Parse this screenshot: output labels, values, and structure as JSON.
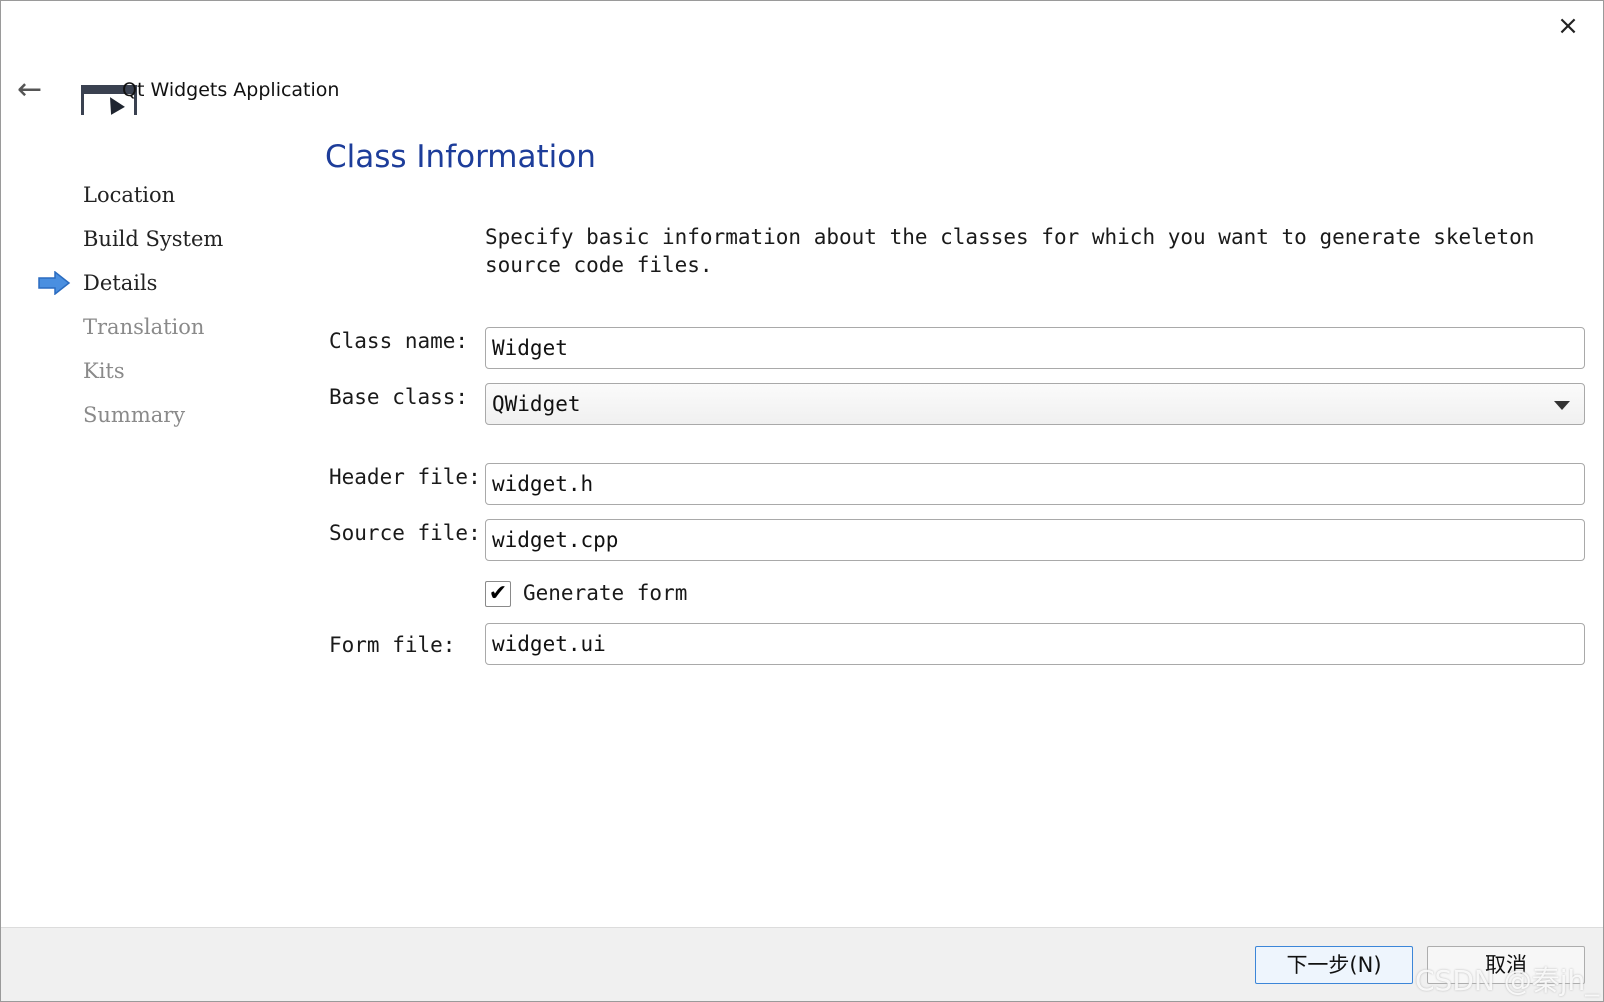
{
  "window": {
    "title": "Qt Widgets Application",
    "close_icon": "×",
    "back_icon": "←"
  },
  "steps": [
    {
      "label": "Location",
      "state": "done"
    },
    {
      "label": "Build System",
      "state": "done"
    },
    {
      "label": "Details",
      "state": "current"
    },
    {
      "label": "Translation",
      "state": "pending"
    },
    {
      "label": "Kits",
      "state": "pending"
    },
    {
      "label": "Summary",
      "state": "pending"
    }
  ],
  "page": {
    "title": "Class Information",
    "description": "Specify basic information about the classes for which you want to generate skeleton source code files."
  },
  "form": {
    "class_name": {
      "label": "Class name:",
      "value": "Widget"
    },
    "base_class": {
      "label": "Base class:",
      "value": "QWidget"
    },
    "header_file": {
      "label": "Header file:",
      "value": "widget.h"
    },
    "source_file": {
      "label": "Source file:",
      "value": "widget.cpp"
    },
    "generate_form": {
      "label": "Generate form",
      "checked": true,
      "check_glyph": "✔"
    },
    "form_file": {
      "label": "Form file:",
      "value": "widget.ui"
    }
  },
  "footer": {
    "next_label": "下一步(N)",
    "cancel_label": "取消"
  },
  "watermark": "CSDN @秦jh_",
  "colors": {
    "title_blue": "#1d3d9a",
    "current_arrow": "#4a8fe0",
    "disabled_text": "#8a8a8a"
  }
}
